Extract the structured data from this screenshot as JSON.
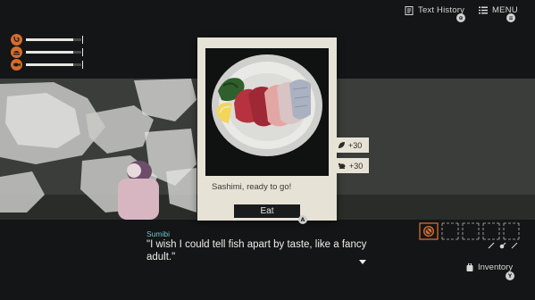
{
  "top_controls": {
    "history_label": "Text History",
    "history_badge": "⊕",
    "menu_label": "MENU",
    "menu_badge": "≡"
  },
  "stats": [
    {
      "icon": "stomach-icon",
      "level": 0.85
    },
    {
      "icon": "food-icon",
      "level": 0.85
    },
    {
      "icon": "fish-icon",
      "level": 0.85
    }
  ],
  "card": {
    "image": "sashimi-plate",
    "caption": "Sashimi, ready to go!",
    "action_label": "Eat",
    "action_badge": "A"
  },
  "effects": [
    {
      "icon": "leaf-icon",
      "value": "+30"
    },
    {
      "icon": "bug-icon",
      "value": "+30"
    }
  ],
  "dialogue": {
    "speaker": "Sumibi",
    "text": "\"I wish I could tell fish apart by taste, like a fancy adult.\""
  },
  "inventory": {
    "label": "Inventory",
    "badge": "Y",
    "slot_count": 5,
    "tools": [
      "pen-icon",
      "knife-icon",
      "spoon-icon"
    ]
  },
  "colors": {
    "accent_orange": "#d56d2d",
    "speaker_teal": "#6cc3c9",
    "card_paper": "#e7e2d6"
  }
}
